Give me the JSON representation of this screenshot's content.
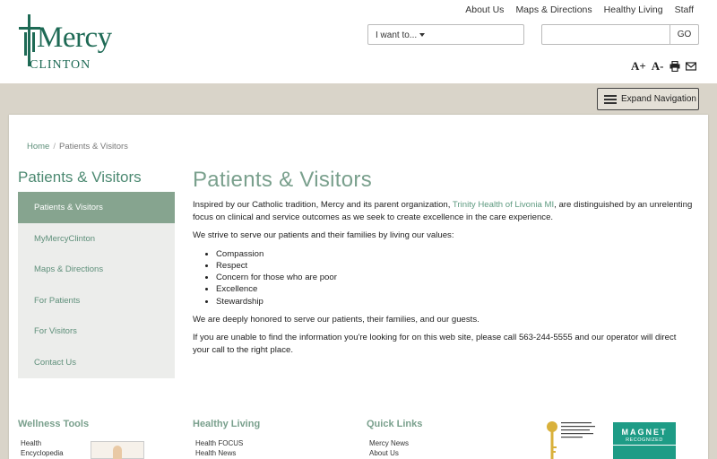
{
  "header": {
    "logo": {
      "word": "Mercy",
      "sub": "CLINTON"
    },
    "top_links": [
      "About Us",
      "Maps & Directions",
      "Healthy Living",
      "Staff"
    ],
    "iwant_label": "I want to...",
    "search_placeholder": "",
    "go_label": "GO",
    "text_increase": "A+",
    "text_decrease": "A-"
  },
  "nav": {
    "expand_label": "Expand Navigation"
  },
  "breadcrumb": {
    "home": "Home",
    "sep": "/",
    "current": "Patients & Visitors"
  },
  "sidebar": {
    "title": "Patients & Visitors",
    "items": [
      {
        "label": "Patients & Visitors",
        "active": true
      },
      {
        "label": "MyMercyClinton"
      },
      {
        "label": "Maps & Directions"
      },
      {
        "label": "For Patients"
      },
      {
        "label": "For Visitors"
      },
      {
        "label": "Contact Us"
      }
    ]
  },
  "main": {
    "title": "Patients & Visitors",
    "p1_before": "Inspired by our Catholic tradition, Mercy and its parent organization, ",
    "p1_link": "Trinity Health of Livonia MI",
    "p1_after": ", are distinguished by an unrelenting focus on clinical and service outcomes as we seek to create excellence in the care experience.",
    "p2": "We strive to serve our patients and their families by living our values:",
    "values": [
      "Compassion",
      "Respect",
      "Concern for those who are poor",
      "Excellence",
      "Stewardship"
    ],
    "p3": "We are deeply honored to serve our patients, their families, and our guests.",
    "p4": "If you are unable to find the information you're looking for on this web site, please call 563-244-5555 and our operator will direct your call to the right place."
  },
  "footer": {
    "wellness": {
      "title": "Wellness Tools",
      "links": [
        "Health",
        "Encyclopedia"
      ]
    },
    "healthy": {
      "title": "Healthy Living",
      "links": [
        "Health FOCUS",
        "Health News"
      ]
    },
    "quick": {
      "title": "Quick Links",
      "links": [
        "Mercy News",
        "About Us"
      ]
    },
    "magnet": {
      "line1": "MAGNET",
      "line2": "RECOGNIZED"
    },
    "colors": {
      "accent": "#7aa08d",
      "sidebar_active": "#86a48f",
      "band": "#d9d4c9",
      "brand": "#1e6a55"
    }
  }
}
